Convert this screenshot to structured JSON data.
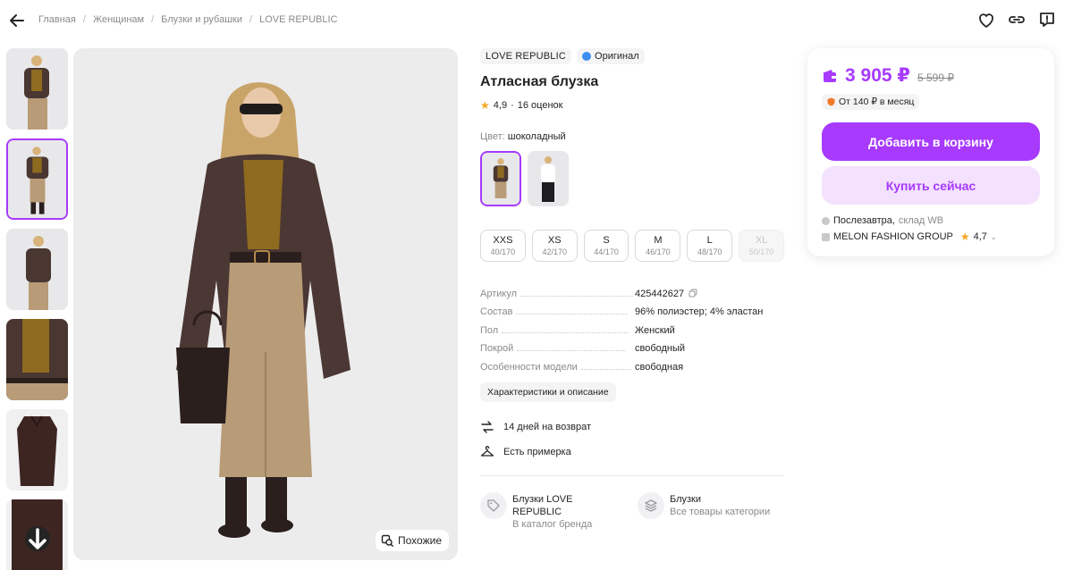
{
  "breadcrumbs": [
    "Главная",
    "Женщинам",
    "Блузки и рубашки",
    "LOVE REPUBLIC"
  ],
  "top_actions": {
    "favorite_icon": "heart-icon",
    "share_icon": "link-icon",
    "report_icon": "report-icon"
  },
  "gallery": {
    "thumbnails_count": 6,
    "active_index": 1,
    "similar_label": "Похожие"
  },
  "product": {
    "brand": "LOVE REPUBLIC",
    "original_label": "Оригинал",
    "title": "Атласная блузка",
    "rating": "4,9",
    "rating_sep": "·",
    "reviews": "16 оценок",
    "color_label": "Цвет:",
    "color_value": "шоколадный",
    "sizes": [
      {
        "size": "XXS",
        "ru": "40/170",
        "available": true
      },
      {
        "size": "XS",
        "ru": "42/170",
        "available": true
      },
      {
        "size": "S",
        "ru": "44/170",
        "available": true
      },
      {
        "size": "M",
        "ru": "46/170",
        "available": true
      },
      {
        "size": "L",
        "ru": "48/170",
        "available": true
      },
      {
        "size": "XL",
        "ru": "50/170",
        "available": false
      }
    ],
    "specs": [
      {
        "key": "Артикул",
        "value": "425442627"
      },
      {
        "key": "Состав",
        "value": "96% полиэстер; 4% эластан"
      },
      {
        "key": "Пол",
        "value": "Женский"
      },
      {
        "key": "Покрой",
        "value": "свободный"
      },
      {
        "key": "Особенности модели",
        "value": "свободная"
      }
    ],
    "description_button": "Характеристики и описание",
    "perks": [
      {
        "icon": "return-icon",
        "label": "14 дней на возврат"
      },
      {
        "icon": "hanger-icon",
        "label": "Есть примерка"
      }
    ],
    "links": [
      {
        "icon": "tag-icon",
        "title": "Блузки LOVE REPUBLIC",
        "subtitle": "В каталог бренда"
      },
      {
        "icon": "stack-icon",
        "title": "Блузки",
        "subtitle": "Все товары категории"
      }
    ]
  },
  "price_card": {
    "price": "3 905 ₽",
    "old_price": "5 599 ₽",
    "installment": "От 140 ₽ в месяц",
    "add_to_cart": "Добавить в корзину",
    "buy_now": "Купить сейчас",
    "delivery": "Послезавтра,",
    "warehouse": "склад WB",
    "seller": "MELON FASHION GROUP",
    "seller_rating": "4,7"
  },
  "colors": {
    "accent": "#a73afd",
    "accent_light": "#f3e1fd",
    "text": "#242424",
    "muted": "#8a8a8a",
    "star": "#f5a623"
  }
}
